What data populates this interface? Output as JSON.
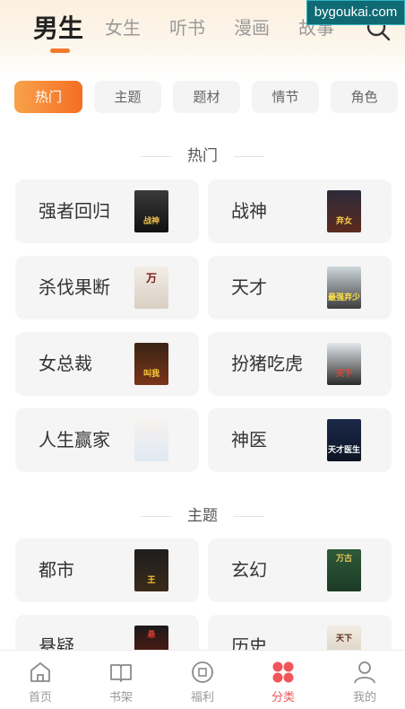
{
  "watermark": "bygoukai.com",
  "top_tabs": [
    {
      "label": "男生",
      "active": true
    },
    {
      "label": "女生"
    },
    {
      "label": "听书"
    },
    {
      "label": "漫画"
    },
    {
      "label": "故事"
    }
  ],
  "filters": [
    "热门",
    "主题",
    "题材",
    "情节",
    "角色"
  ],
  "sections": [
    {
      "title": "热门",
      "cards": [
        {
          "label": "强者回归",
          "cover_text": "战神"
        },
        {
          "label": "战神",
          "cover_text": "弃女"
        },
        {
          "label": "杀伐果断",
          "cover_text": "万"
        },
        {
          "label": "天才",
          "cover_text": "最强弃少"
        },
        {
          "label": "女总裁",
          "cover_text": "叫我"
        },
        {
          "label": "扮猪吃虎",
          "cover_text": "天下"
        },
        {
          "label": "人生赢家",
          "cover_text": ""
        },
        {
          "label": "神医",
          "cover_text": "天才医生"
        }
      ]
    },
    {
      "title": "主题",
      "cards": [
        {
          "label": "都市",
          "cover_text": "王"
        },
        {
          "label": "玄幻",
          "cover_text": "万古"
        },
        {
          "label": "悬疑",
          "cover_text": "悬"
        },
        {
          "label": "历史",
          "cover_text": "天下"
        }
      ]
    }
  ],
  "bottom_nav": [
    {
      "label": "首页",
      "icon": "home-icon"
    },
    {
      "label": "书架",
      "icon": "bookshelf-icon"
    },
    {
      "label": "福利",
      "icon": "welfare-icon"
    },
    {
      "label": "分类",
      "icon": "category-icon",
      "active": true
    },
    {
      "label": "我的",
      "icon": "profile-icon"
    }
  ],
  "colors": {
    "accent": "#f46e24",
    "nav_active": "#f0555a"
  }
}
